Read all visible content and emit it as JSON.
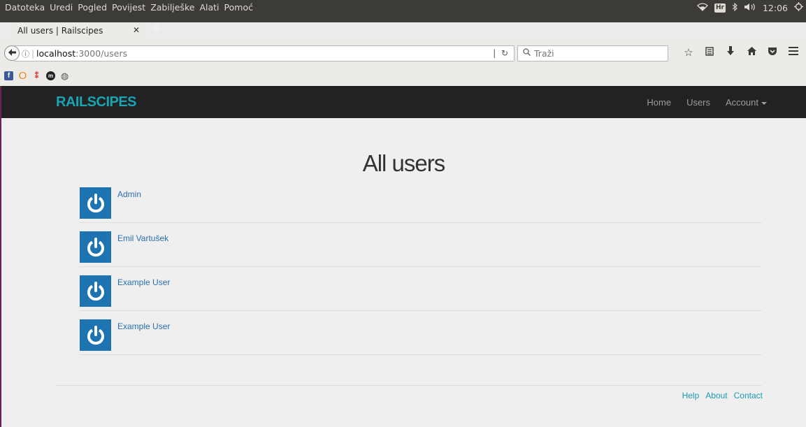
{
  "os": {
    "menu": [
      "Datoteka",
      "Uredi",
      "Pogled",
      "Povijest",
      "Zabilješke",
      "Alati",
      "Pomoć"
    ],
    "keyboard_layout": "Hr",
    "clock": "12:06"
  },
  "browser": {
    "tab_title": "All users | Railscipes",
    "url_host": "localhost",
    "url_path": ":3000/users",
    "search_placeholder": "Traži"
  },
  "navbar": {
    "brand": "RAILSCIPES",
    "links": [
      "Home",
      "Users",
      "Account"
    ]
  },
  "main": {
    "title": "All users",
    "users": [
      "Admin",
      "Emil Vartušek",
      "Example User",
      "Example User"
    ]
  },
  "footer": {
    "links": [
      "Help",
      "About",
      "Contact"
    ]
  },
  "colors": {
    "brand": "#1aa3b3",
    "navbar_bg": "#222222",
    "avatar_bg": "#1e74b0",
    "link": "#2a6fb0",
    "footer_link": "#1a9bb0"
  }
}
